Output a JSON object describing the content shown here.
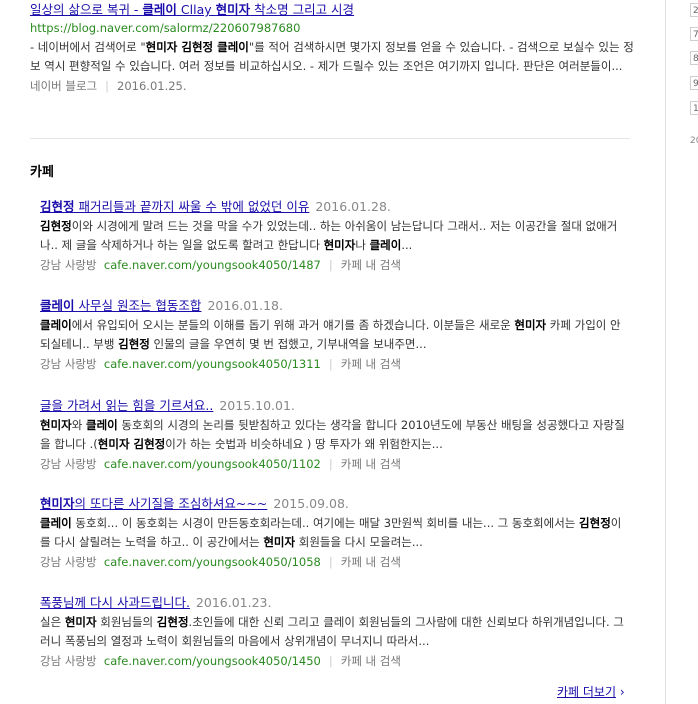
{
  "top_result": {
    "title_pre": "일상의 삶으로 복귀 - ",
    "title_b1": "클레이",
    "title_mid": " Cllay ",
    "title_b2": "현미자",
    "title_post": " 착소명 그리고 시경",
    "url": "https://blog.naver.com/salormz/220607987680",
    "desc1": "- 네이버에서 검색어로 \"",
    "desc_b": "현미자 김현정 클레이",
    "desc2": "\"를 적어 검색하시면 몇가지 정보를 얻을 수 있습니다. - 검색으로 보실수 있는 정보 역시 편향적일 수 있습니다. 여러 정보를 비교하십시오. - 제가 드릴수 있는 조언은 여기까지 입니다. 판단은 여러분들이...",
    "source": "네이버 블로그",
    "date": "2016.01.25."
  },
  "section": {
    "title": "카페"
  },
  "cafe_items": [
    {
      "t_b": "김현정",
      "t_rest": " 패거리들과 끝까지 싸울 수 밖에 없었던 이유",
      "date": "2016.01.28.",
      "d_b1": "김현정",
      "d1": "이와 시경에게 말려 드는 것을 막을 수가 있었는데.. 하는 아쉬움이 남는답니다 그래서.. 저는 이공간을 절대 없애거나.. 제 글을 삭제하거나 하는 일을 없도록 할려고 한답니다 ",
      "d_b2": "현미자",
      "d2": "나 ",
      "d_b3": "클레이",
      "d3": "...",
      "cafe": "강남 사랑방",
      "url": "cafe.naver.com/youngsook4050/1487",
      "search": "카페 내 검색"
    },
    {
      "t_b": "클레이",
      "t_rest": " 사무실 원조는 협동조합",
      "date": "2016.01.18.",
      "d_b1": "클레이",
      "d1": "에서 유입되어 오시는 분들의 이해를 돕기 위해 과거 얘기를 좀 하겠습니다. 이분들은 새로운 ",
      "d_b2": "현미자",
      "d2": " 카페 가입이 안되실테니.. 부뱅 ",
      "d_b3": "김현정",
      "d3": " 인물의 글을 우연히 몇 번 접했고, 기부내역을 보내주면...",
      "cafe": "강남 사랑방",
      "url": "cafe.naver.com/youngsook4050/1311",
      "search": "카페 내 검색"
    },
    {
      "t_b": "",
      "t_rest": "글을 가려서 읽는 힘을 기르셔요..",
      "date": "2015.10.01.",
      "d_b1": "현미자",
      "d1": "와 ",
      "d_b2": "클레이",
      "d2": " 동호회의 시경의 논리를 뒷받침하고 있다는 생각을 합니다 2010년도에 부동산 배팅을 성공했다고 자랑질을 합니다 .(",
      "d_b3": "현미자 김현정",
      "d3": "이가 하는 숫법과 비슷하네요 ) 땅 투자가 왜 위험한지는...",
      "cafe": "강남 사랑방",
      "url": "cafe.naver.com/youngsook4050/1102",
      "search": "카페 내 검색"
    },
    {
      "t_b": "현미자",
      "t_rest": "의 또다른 사기질을 조심하셔요~~~",
      "date": "2015.09.08.",
      "d_b1": "클레이",
      "d1": " 동호회... 이 동호회는 시경이 만든동호회라는데.. 여기에는 매달 3만원씩 회비를 내는... 그 동호회에서는 ",
      "d_b2": "김현정",
      "d2": "이를 다시 살릴려는 노력을 하고.. 이 공간에서는 ",
      "d_b3": "현미자",
      "d3": " 회원들을 다시 모을려는...",
      "cafe": "강남 사랑방",
      "url": "cafe.naver.com/youngsook4050/1058",
      "search": "카페 내 검색"
    },
    {
      "t_b": "",
      "t_rest": "폭풍님께 다시 사과드립니다.",
      "date": "2016.01.23.",
      "d_b1": "",
      "d1": "실은 ",
      "d_b2": "현미자",
      "d2": " 회원님들의 ",
      "d_b3": "김현정",
      "d3": ".초인들에 대한 신뢰 그리고 클레이 회원님들의 그사람에 대한 신뢰보다 하위개념입니다. 그러니 폭풍님의 열정과 노력이 회원님들의 마음에서 상위개념이 무너지니 따라서...",
      "cafe": "강남 사랑방",
      "url": "cafe.naver.com/youngsook4050/1450",
      "search": "카페 내 검색"
    }
  ],
  "more": {
    "label": "카페 더보기",
    "arrow": "›"
  },
  "rightbar": {
    "nums": [
      "2",
      "7",
      "8",
      "9",
      "1"
    ],
    "text": "20"
  }
}
